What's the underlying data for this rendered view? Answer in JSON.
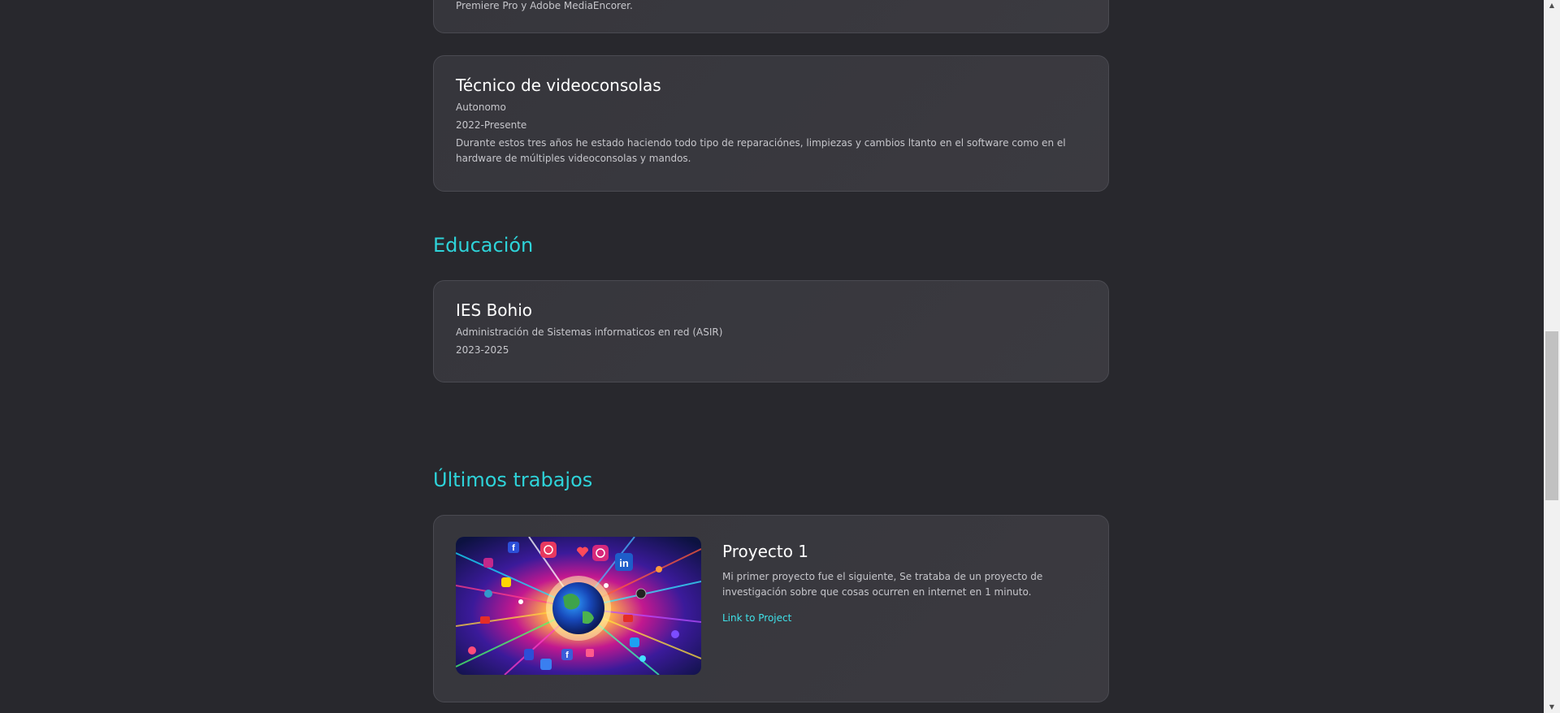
{
  "colors": {
    "page_background": "#28282d",
    "card_background": "#38373d",
    "card_border": "#4a4a51",
    "accent": "#2ed3d9",
    "text_primary": "#ffffff",
    "text_secondary": "#c6c6cb"
  },
  "previous_card": {
    "desc_tail": "Premiere Pro y Adobe MediaEncorer."
  },
  "experience": [
    {
      "title": "Técnico de videoconsolas",
      "company": "Autonomo",
      "period": "2022-Presente",
      "description": "Durante estos tres años he estado haciendo todo tipo de reparaciónes, limpiezas y cambios ltanto en el software como en el hardware de múltiples videoconsolas y mandos."
    }
  ],
  "education": {
    "heading": "Educación",
    "items": [
      {
        "title": "IES Bohio",
        "degree": "Administración de Sistemas informaticos en red (ASIR)",
        "period": "2023-2025"
      }
    ]
  },
  "works": {
    "heading": "Últimos trabajos",
    "projects": [
      {
        "title": "Proyecto 1",
        "description": "Mi primer proyecto fue el siguiente, Se trataba de un proyecto de investigación sobre que cosas ocurren en internet en 1 minuto.",
        "link_label": "Link to Project",
        "image_icons": [
          "facebook-icon",
          "instagram-icon",
          "linkedin-icon",
          "twitter-icon",
          "youtube-icon",
          "heart-icon",
          "globe-icon"
        ]
      }
    ]
  },
  "scrollbar": {
    "up_arrow": "▲",
    "down_arrow": "▼",
    "scroll_position": 0.62
  }
}
